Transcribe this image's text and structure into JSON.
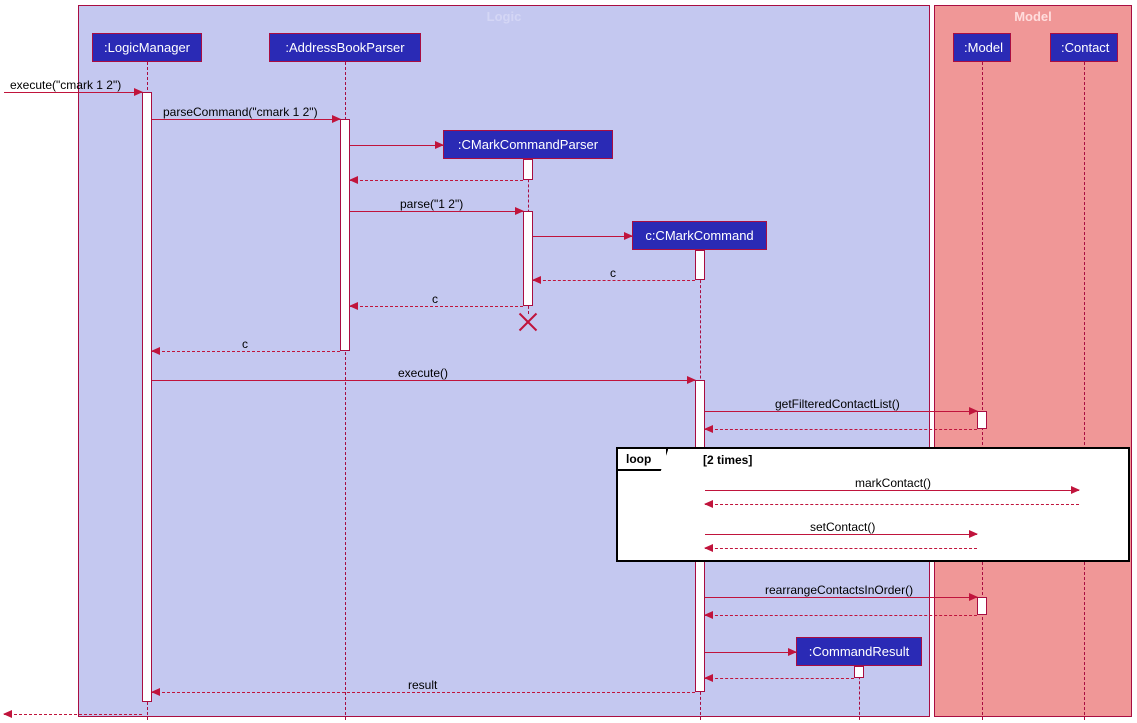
{
  "boxes": {
    "logic": "Logic",
    "model": "Model"
  },
  "participants": {
    "logicManager": ":LogicManager",
    "addressBookParser": ":AddressBookParser",
    "cMarkCommandParser": ":CMarkCommandParser",
    "cMarkCommand": "c:CMarkCommand",
    "commandResult": ":CommandResult",
    "model": ":Model",
    "contact": ":Contact"
  },
  "messages": {
    "executeCmark": "execute(\"cmark 1 2\")",
    "parseCommand": "parseCommand(\"cmark 1 2\")",
    "parse": "parse(\"1 2\")",
    "returnC1": "c",
    "returnC2": "c",
    "returnC3": "c",
    "execute": "execute()",
    "getFilteredContactList": "getFilteredContactList()",
    "markContact": "markContact()",
    "setContact": "setContact()",
    "rearrangeContactsInOrder": "rearrangeContactsInOrder()",
    "result": "result"
  },
  "loop": {
    "label": "loop",
    "condition": "[2 times]"
  },
  "chart_data": {
    "type": "sequence_diagram",
    "boxes": [
      {
        "name": "Logic",
        "participants": [
          "LogicManager",
          "AddressBookParser",
          "CMarkCommandParser",
          "c:CMarkCommand",
          "CommandResult"
        ]
      },
      {
        "name": "Model",
        "participants": [
          "Model",
          "Contact"
        ]
      }
    ],
    "participants": [
      {
        "id": "client",
        "name": "",
        "external": true
      },
      {
        "id": "LogicManager",
        "name": ":LogicManager"
      },
      {
        "id": "AddressBookParser",
        "name": ":AddressBookParser"
      },
      {
        "id": "CMarkCommandParser",
        "name": ":CMarkCommandParser",
        "created": true,
        "destroyed": true
      },
      {
        "id": "CMarkCommand",
        "name": "c:CMarkCommand",
        "created": true
      },
      {
        "id": "CommandResult",
        "name": ":CommandResult",
        "created": true
      },
      {
        "id": "Model",
        "name": ":Model"
      },
      {
        "id": "Contact",
        "name": ":Contact"
      }
    ],
    "messages": [
      {
        "from": "client",
        "to": "LogicManager",
        "label": "execute(\"cmark 1 2\")",
        "type": "sync"
      },
      {
        "from": "LogicManager",
        "to": "AddressBookParser",
        "label": "parseCommand(\"cmark 1 2\")",
        "type": "sync"
      },
      {
        "from": "AddressBookParser",
        "to": "CMarkCommandParser",
        "label": "",
        "type": "create"
      },
      {
        "from": "CMarkCommandParser",
        "to": "AddressBookParser",
        "label": "",
        "type": "return"
      },
      {
        "from": "AddressBookParser",
        "to": "CMarkCommandParser",
        "label": "parse(\"1 2\")",
        "type": "sync"
      },
      {
        "from": "CMarkCommandParser",
        "to": "CMarkCommand",
        "label": "",
        "type": "create"
      },
      {
        "from": "CMarkCommand",
        "to": "CMarkCommandParser",
        "label": "c",
        "type": "return"
      },
      {
        "from": "CMarkCommandParser",
        "to": "AddressBookParser",
        "label": "c",
        "type": "return"
      },
      {
        "from": "CMarkCommandParser",
        "to": "",
        "label": "",
        "type": "destroy"
      },
      {
        "from": "AddressBookParser",
        "to": "LogicManager",
        "label": "c",
        "type": "return"
      },
      {
        "from": "LogicManager",
        "to": "CMarkCommand",
        "label": "execute()",
        "type": "sync"
      },
      {
        "from": "CMarkCommand",
        "to": "Model",
        "label": "getFilteredContactList()",
        "type": "sync"
      },
      {
        "from": "Model",
        "to": "CMarkCommand",
        "label": "",
        "type": "return"
      },
      {
        "fragment": "loop",
        "condition": "[2 times]",
        "messages": [
          {
            "from": "CMarkCommand",
            "to": "Contact",
            "label": "markContact()",
            "type": "sync"
          },
          {
            "from": "Contact",
            "to": "CMarkCommand",
            "label": "",
            "type": "return"
          },
          {
            "from": "CMarkCommand",
            "to": "Model",
            "label": "setContact()",
            "type": "sync"
          },
          {
            "from": "Model",
            "to": "CMarkCommand",
            "label": "",
            "type": "return"
          }
        ]
      },
      {
        "from": "CMarkCommand",
        "to": "Model",
        "label": "rearrangeContactsInOrder()",
        "type": "sync"
      },
      {
        "from": "Model",
        "to": "CMarkCommand",
        "label": "",
        "type": "return"
      },
      {
        "from": "CMarkCommand",
        "to": "CommandResult",
        "label": "",
        "type": "create"
      },
      {
        "from": "CommandResult",
        "to": "CMarkCommand",
        "label": "",
        "type": "return"
      },
      {
        "from": "CMarkCommand",
        "to": "LogicManager",
        "label": "result",
        "type": "return"
      },
      {
        "from": "LogicManager",
        "to": "client",
        "label": "",
        "type": "return"
      }
    ]
  }
}
